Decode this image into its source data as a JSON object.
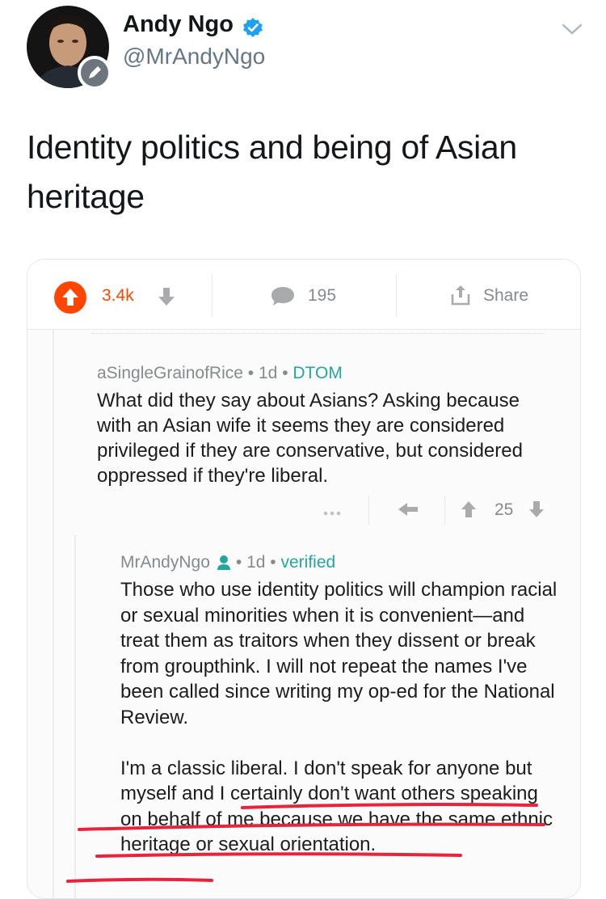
{
  "tweet": {
    "author": {
      "display_name": "Andy Ngo",
      "handle": "@MrAndyNgo"
    },
    "text": "Identity politics and being of Asian heritage"
  },
  "card": {
    "action_bar": {
      "upvotes": "3.4k",
      "comments": "195",
      "share_label": "Share"
    },
    "comment1": {
      "username": "aSingleGrainofRice",
      "age": "1d",
      "flair": "DTOM",
      "separator": "•",
      "text": "What did they say about Asians? Asking because with an Asian wife it seems they are considered privileged if they are conservative, but considered oppressed if they're liberal.",
      "score": "25"
    },
    "comment2": {
      "username": "MrAndyNgo",
      "age": "1d",
      "flair": "verified",
      "separator": "•",
      "paragraphs": [
        "Those who use identity politics will champion racial or sexual minorities when it is convenient—and treat them as traitors when they dissent or break from groupthink. I will not repeat the names I've been called since writing my op-ed for the National Review.",
        "I'm a classic liberal. I don't speak for anyone but myself and I certainly don't want others speaking on behalf of me because we have the same ethnic heritage or sexual orientation."
      ]
    }
  },
  "colors": {
    "upvote": "#ff4500",
    "flair": "#26a69a",
    "verified_badge": "#1da1f2",
    "red_marker": "#e8243c",
    "muted": "#878a8c"
  },
  "icons": [
    "verified-icon",
    "caret-down-icon",
    "upvote-icon",
    "downvote-icon",
    "comment-icon",
    "share-icon",
    "more-icon",
    "reply-icon",
    "user-icon",
    "edit-icon"
  ]
}
